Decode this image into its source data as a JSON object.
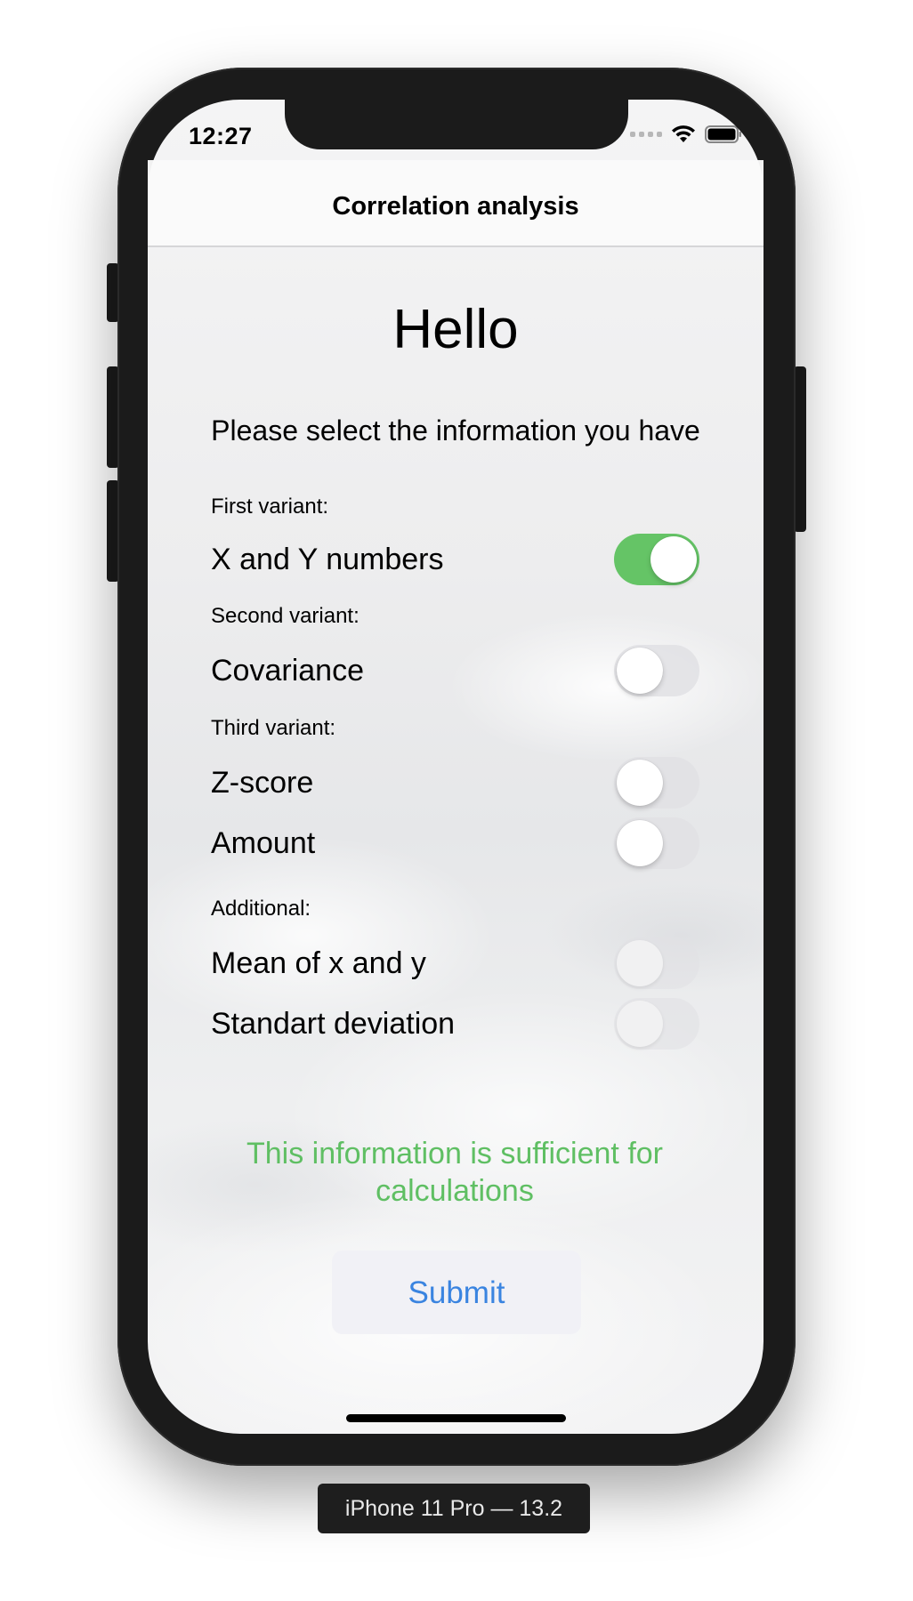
{
  "status_bar": {
    "time": "12:27"
  },
  "nav": {
    "title": "Correlation analysis"
  },
  "main": {
    "greeting": "Hello",
    "prompt": "Please select the information you have",
    "sections": {
      "first": "First variant:",
      "second": "Second variant:",
      "third": "Third variant:",
      "additional": "Additional:"
    },
    "toggles": [
      {
        "label": "X and Y numbers",
        "state": "on"
      },
      {
        "label": "Covariance",
        "state": "off"
      },
      {
        "label": "Z-score",
        "state": "off"
      },
      {
        "label": "Amount",
        "state": "off"
      },
      {
        "label": "Mean of x and y",
        "state": "disabled"
      },
      {
        "label": "Standart deviation",
        "state": "disabled"
      }
    ],
    "message": "This information is sufficient for calculations",
    "submit_label": "Submit"
  },
  "device_label": "iPhone 11 Pro — 13.2",
  "colors": {
    "toggle_on": "#65c466",
    "message": "#5fbf63",
    "submit_text": "#3a84e0"
  },
  "icons": {
    "signal": "cellular-signal-icon",
    "wifi": "wifi-icon",
    "battery": "battery-icon"
  }
}
